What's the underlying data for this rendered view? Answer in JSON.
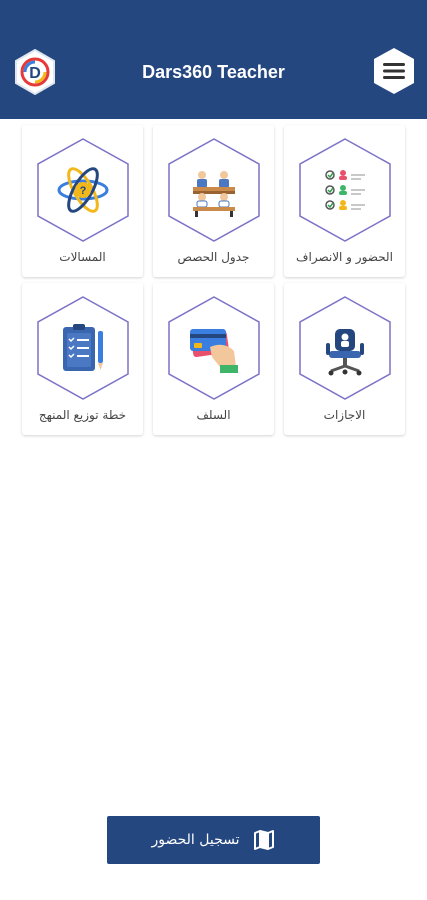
{
  "app": {
    "title": "Dars360 Teacher",
    "logo_letter": "D",
    "colors": {
      "primary": "#24477f",
      "hex_outline": "#7c72c7"
    }
  },
  "menu": {
    "icon": "hamburger-menu-icon"
  },
  "tiles": [
    {
      "label": "الحضور و الانصراف",
      "icon": "attendance-checklist-icon"
    },
    {
      "label": "جدول الحصص",
      "icon": "classroom-desks-icon"
    },
    {
      "label": "المسالات",
      "icon": "atom-question-icon"
    },
    {
      "label": "الاجازات",
      "icon": "office-chair-icon"
    },
    {
      "label": "السلف",
      "icon": "hand-card-icon"
    },
    {
      "label": "خطة توزيع المنهج",
      "icon": "clipboard-plan-icon"
    }
  ],
  "bottom": {
    "label": "تسجيل الحضور",
    "icon": "map-icon"
  }
}
